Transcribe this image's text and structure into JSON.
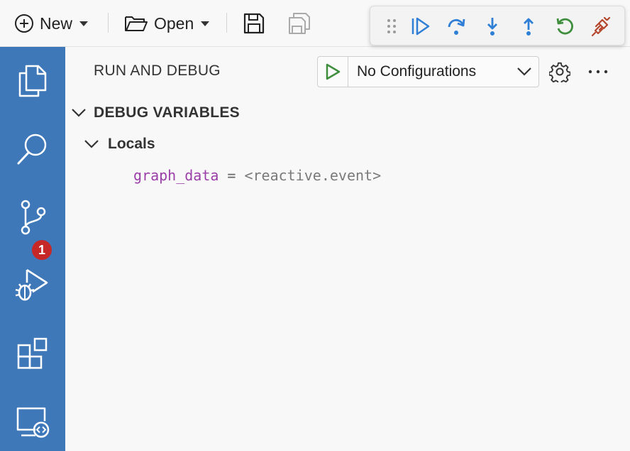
{
  "toolbar": {
    "new_label": "New",
    "open_label": "Open",
    "icons": [
      "plus-circle-icon",
      "folder-open-icon",
      "save-icon",
      "save-all-icon"
    ]
  },
  "debug_toolbar": {
    "icons": [
      "drag-handle-icon",
      "continue-icon",
      "step-over-icon",
      "step-into-icon",
      "step-out-icon",
      "restart-icon",
      "disconnect-icon"
    ],
    "colors": {
      "blue": "#2f7fd6",
      "green": "#3e8e3e",
      "red": "#b5452b"
    }
  },
  "activity_bar": {
    "color": "#3f78b9",
    "items": [
      "explorer-icon",
      "search-icon",
      "source-control-icon",
      "run-debug-icon",
      "extensions-icon",
      "remote-explorer-icon"
    ],
    "debug_badge": "1"
  },
  "panel": {
    "title": "RUN AND DEBUG",
    "configuration": "No Configurations",
    "section_title": "DEBUG VARIABLES",
    "group_title": "Locals",
    "variables": [
      {
        "name": "graph_data",
        "equals": "=",
        "value": "<reactive.event>"
      }
    ]
  }
}
